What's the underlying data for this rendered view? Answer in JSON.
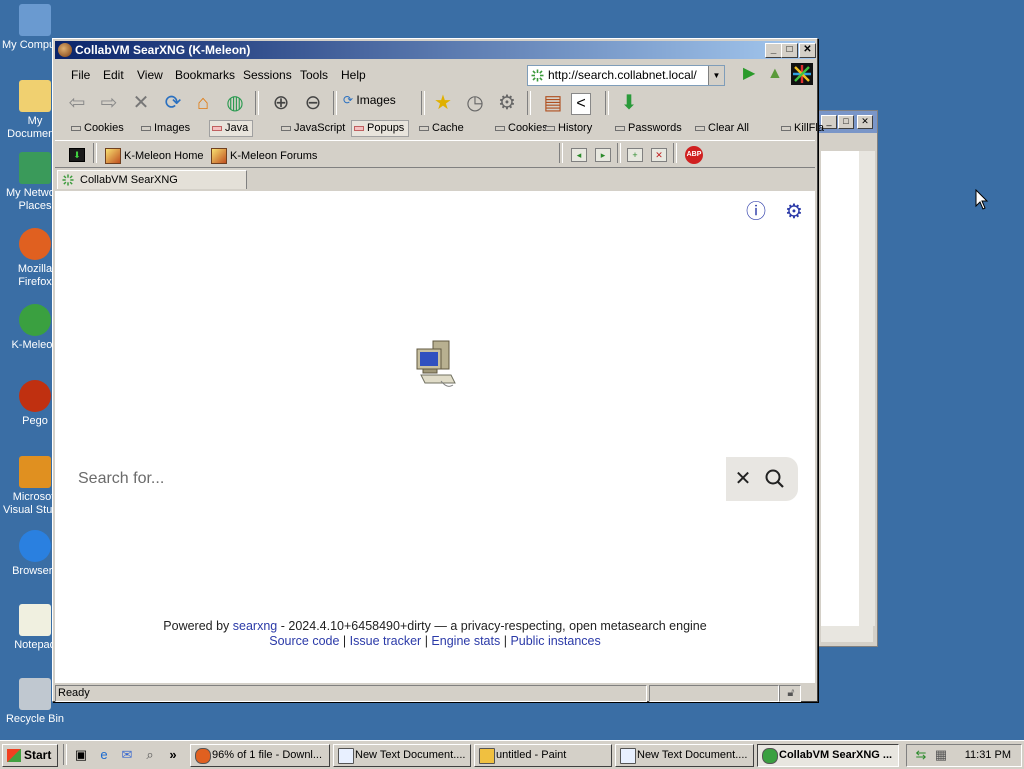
{
  "desktop": {
    "icons": [
      {
        "label": "My Computer",
        "icon": "my-computer-icon"
      },
      {
        "label": "My Documents",
        "icon": "my-documents-icon"
      },
      {
        "label": "My Network Places",
        "icon": "network-places-icon"
      },
      {
        "label": "Mozilla Firefox",
        "icon": "firefox-icon"
      },
      {
        "label": "K-Meleon",
        "icon": "kmeleon-icon"
      },
      {
        "label": "Pego",
        "icon": "pego-icon"
      },
      {
        "label": "Microsoft Visual Studio",
        "icon": "visual-studio-icon"
      },
      {
        "label": "Browserv",
        "icon": "browser-icon"
      },
      {
        "label": "Notepad",
        "icon": "notepad-icon"
      },
      {
        "label": "Recycle Bin",
        "icon": "recycle-bin-icon"
      }
    ]
  },
  "window": {
    "title": "CollabVM SearXNG (K-Meleon)",
    "menu": [
      "File",
      "Edit",
      "View",
      "Bookmarks",
      "Sessions",
      "Tools",
      "Help"
    ],
    "url": "http://search.collabnet.local/",
    "images_label": "Images",
    "prefs": [
      "Cookies",
      "Images",
      "Java",
      "JavaScript",
      "Popups",
      "Cache",
      "Cookies",
      "History",
      "Passwords",
      "Clear All",
      "KillFla"
    ],
    "links": [
      "K-Meleon Home",
      "K-Meleon Forums"
    ],
    "tab_title": "CollabVM SearXNG",
    "status": "Ready"
  },
  "page": {
    "search_placeholder": "Search for...",
    "footer": {
      "powered_by": "Powered by",
      "searxng_link": "searxng",
      "version_text": "- 2024.4.10+6458490+dirty — a privacy-respecting, open metasearch engine",
      "source_code": "Source code",
      "issue_tracker": "Issue tracker",
      "engine_stats": "Engine stats",
      "public_instances": "Public instances",
      "separator": "|"
    }
  },
  "taskbar": {
    "start": "Start",
    "tasks": [
      {
        "label": "96% of 1 file - Downl...",
        "icon": "firefox-icon",
        "active": false
      },
      {
        "label": "New Text Document....",
        "icon": "notepad-icon",
        "active": false
      },
      {
        "label": "untitled - Paint",
        "icon": "paint-icon",
        "active": false
      },
      {
        "label": "New Text Document....",
        "icon": "notepad-icon",
        "active": false
      },
      {
        "label": "CollabVM SearXNG ...",
        "icon": "kmeleon-icon",
        "active": true
      }
    ],
    "clock": "11:31 PM"
  },
  "colors": {
    "desktop": "#3a6ea5",
    "title_active": "#0a246a",
    "link": "#2b3aa8"
  }
}
